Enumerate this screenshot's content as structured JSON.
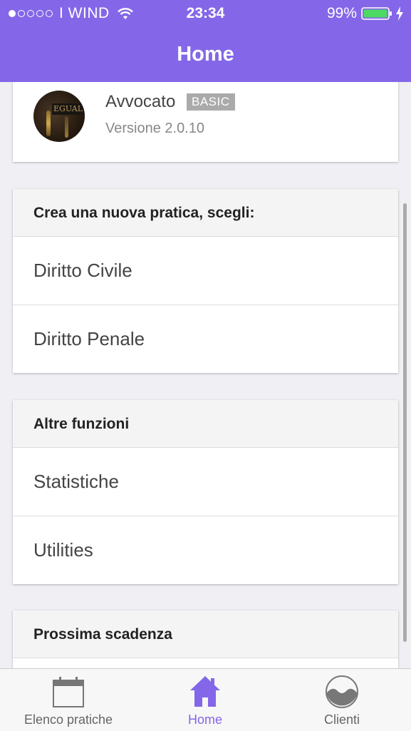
{
  "status_bar": {
    "carrier": "WIND",
    "time": "23:34",
    "battery": "99%",
    "signal_bars_filled": 1,
    "signal_bars_total": 5
  },
  "header": {
    "title": "Home"
  },
  "profile": {
    "app_name": "Avvocato",
    "badge": "BASIC",
    "version": "Versione 2.0.10"
  },
  "sections": {
    "create": {
      "title": "Crea una nuova pratica, scegli:",
      "items": [
        "Diritto Civile",
        "Diritto Penale"
      ]
    },
    "other": {
      "title": "Altre funzioni",
      "items": [
        "Statistiche",
        "Utilities"
      ]
    },
    "next": {
      "title": "Prossima scadenza"
    }
  },
  "tabbar": {
    "tabs": [
      {
        "label": "Elenco pratiche",
        "icon": "calendar-icon"
      },
      {
        "label": "Home",
        "icon": "home-icon",
        "active": true
      },
      {
        "label": "Clienti",
        "icon": "clients-icon"
      }
    ]
  },
  "colors": {
    "accent": "#8467e8"
  }
}
